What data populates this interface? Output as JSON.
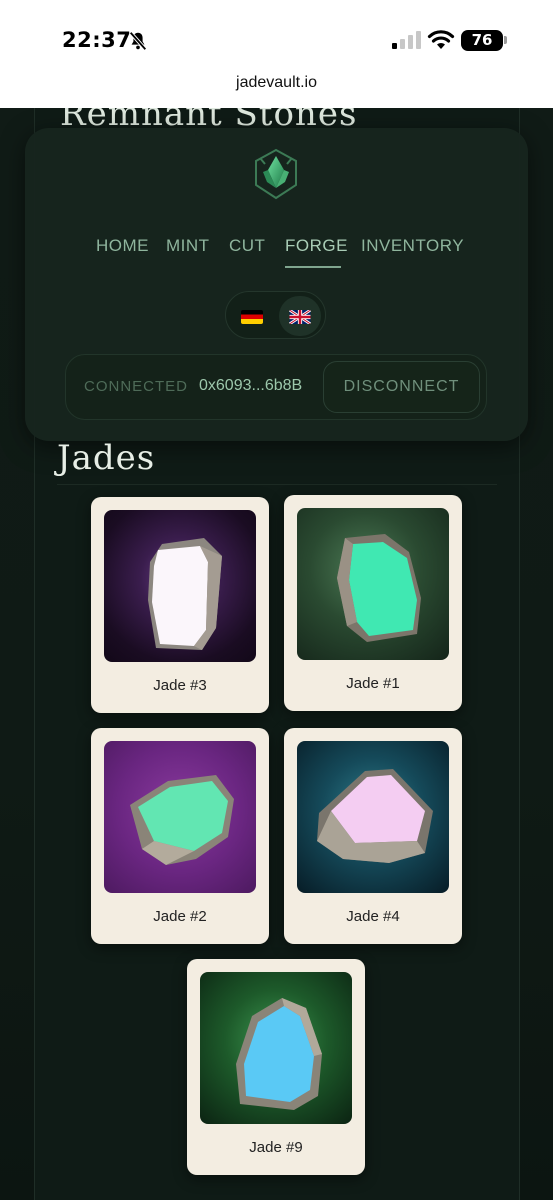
{
  "status_bar": {
    "time": "22:37",
    "battery": "76"
  },
  "browser": {
    "url": "jadevault.io"
  },
  "page": {
    "previous_section_title": "Remnant Stones"
  },
  "nav": {
    "items": [
      {
        "label": "HOME",
        "active": false
      },
      {
        "label": "MINT",
        "active": false
      },
      {
        "label": "CUT",
        "active": false
      },
      {
        "label": "FORGE",
        "active": true
      },
      {
        "label": "INVENTORY",
        "active": false
      }
    ]
  },
  "language": {
    "options": [
      "de",
      "en"
    ],
    "selected": "en"
  },
  "wallet": {
    "status": "CONNECTED",
    "address": "0x6093...6b8B",
    "disconnect_label": "DISCONNECT"
  },
  "jades": {
    "title": "Jades",
    "items": [
      {
        "name": "Jade #3",
        "stone_color": "#ffffff",
        "background": "purple-dark"
      },
      {
        "name": "Jade #1",
        "stone_color": "#3de6b0",
        "background": "green"
      },
      {
        "name": "Jade #2",
        "stone_color": "#5fe8b0",
        "background": "purple"
      },
      {
        "name": "Jade #4",
        "stone_color": "#f2c8f0",
        "background": "teal"
      },
      {
        "name": "Jade #9",
        "stone_color": "#56c8f4",
        "background": "forest"
      }
    ]
  }
}
